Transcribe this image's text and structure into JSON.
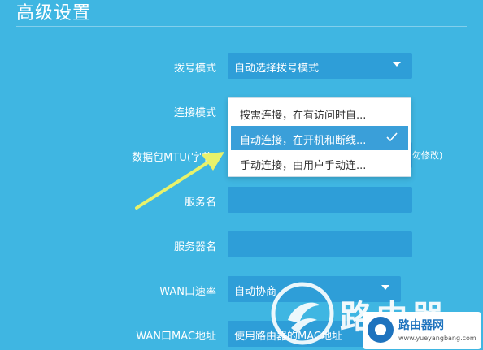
{
  "page": {
    "title": "高级设置"
  },
  "form": {
    "dial_mode": {
      "label": "拨号模式",
      "value": "自动选择拨号模式"
    },
    "connect_mode": {
      "label": "连接模式"
    },
    "mtu": {
      "label": "数据包MTU(字节)",
      "hint": "勿修改)"
    },
    "service_name": {
      "label": "服务名",
      "value": ""
    },
    "server_name": {
      "label": "服务器名",
      "value": ""
    },
    "wan_speed": {
      "label": "WAN口速率",
      "value": "自动协商"
    },
    "wan_mac": {
      "label": "WAN口MAC地址",
      "value": "使用路由器的MAC地址"
    }
  },
  "dropdown": {
    "options": [
      {
        "label": "按需连接，在有访问时自...",
        "selected": false
      },
      {
        "label": "自动连接，在开机和断线...",
        "selected": true
      },
      {
        "label": "手动连接，由用户手动连...",
        "selected": false
      }
    ]
  },
  "watermark": {
    "brand": "路由器",
    "badge_name": "路由器网",
    "badge_url": "www.yueyangbang.com"
  },
  "colors": {
    "background": "#3fb6e2",
    "field": "#2e9ed8",
    "selected_option": "#3a9fd9",
    "arrow": "#e8f26a"
  }
}
